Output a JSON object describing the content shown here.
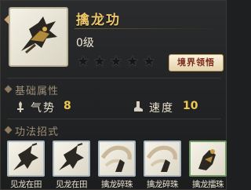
{
  "skill": {
    "name": "擒龙功",
    "level": "0级",
    "stars": [
      "★",
      "★",
      "★",
      "★",
      "★"
    ],
    "realm_button": "境界领悟",
    "icon": "dragon-claw-icon"
  },
  "attributes": {
    "title": "基础属性",
    "stats": [
      {
        "label": "气势",
        "value": "8",
        "icon": "sword-icon"
      },
      {
        "label": "速度",
        "value": "10",
        "icon": "boot-icon"
      }
    ]
  },
  "moves": {
    "title": "功法招式",
    "items": [
      {
        "label": "见龙在田",
        "icon": "martial-pose-icon",
        "frame": "blue"
      },
      {
        "label": "见龙在田",
        "icon": "martial-pose-icon",
        "frame": "blue"
      },
      {
        "label": "擒龙碎珠",
        "icon": "spiral-strike-icon",
        "frame": "blue"
      },
      {
        "label": "擒龙碎珠",
        "icon": "spiral-strike-icon",
        "frame": "blue"
      },
      {
        "label": "擒龙擂珠",
        "icon": "dragon-grab-icon",
        "frame": "green"
      }
    ]
  },
  "colors": {
    "accent_gold": "#f0c76a",
    "value_gold": "#f0c84e",
    "button_text": "#7a2a18"
  }
}
